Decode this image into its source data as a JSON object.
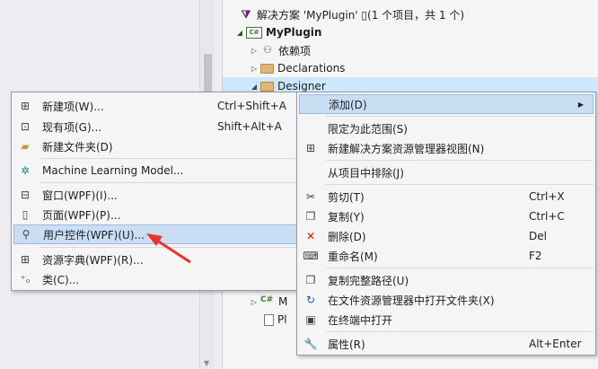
{
  "solution_explorer": {
    "solution_label": "解决方案 'MyPlugin' ▯(1 个项目，共 1 个)",
    "project_label": "MyPlugin",
    "deps_label": "依赖项",
    "declarations_label": "Declarations",
    "designer_label": "Designer",
    "partial_m_label": "M",
    "partial_pl_label": "Pl"
  },
  "left_menu": {
    "items": [
      {
        "icon": "new-item-icon",
        "label": "新建项(W)...",
        "shortcut": "Ctrl+Shift+A"
      },
      {
        "icon": "existing-item-icon",
        "label": "现有项(G)...",
        "shortcut": "Shift+Alt+A"
      },
      {
        "icon": "new-folder-icon",
        "label": "新建文件夹(D)",
        "shortcut": ""
      },
      {
        "icon": "ml-model-icon",
        "label": "Machine Learning Model...",
        "shortcut": ""
      },
      {
        "icon": "window-icon",
        "label": "窗口(WPF)(I)...",
        "shortcut": ""
      },
      {
        "icon": "page-icon",
        "label": "页面(WPF)(P)...",
        "shortcut": ""
      },
      {
        "icon": "user-control-icon",
        "label": "用户控件(WPF)(U)...",
        "shortcut": ""
      },
      {
        "icon": "resource-dictionary-icon",
        "label": "资源字典(WPF)(R)...",
        "shortcut": ""
      },
      {
        "icon": "class-icon",
        "label": "类(C)...",
        "shortcut": ""
      }
    ]
  },
  "right_menu": {
    "items": [
      {
        "icon": "",
        "label": "添加(D)",
        "shortcut": ""
      },
      {
        "icon": "",
        "label": "限定为此范围(S)",
        "shortcut": ""
      },
      {
        "icon": "new-view-icon",
        "label": "新建解决方案资源管理器视图(N)",
        "shortcut": ""
      },
      {
        "icon": "",
        "label": "从项目中排除(J)",
        "shortcut": ""
      },
      {
        "icon": "cut-icon",
        "label": "剪切(T)",
        "shortcut": "Ctrl+X"
      },
      {
        "icon": "copy-icon",
        "label": "复制(Y)",
        "shortcut": "Ctrl+C"
      },
      {
        "icon": "delete-icon",
        "label": "删除(D)",
        "shortcut": "Del"
      },
      {
        "icon": "rename-icon",
        "label": "重命名(M)",
        "shortcut": "F2"
      },
      {
        "icon": "copy-path-icon",
        "label": "复制完整路径(U)",
        "shortcut": ""
      },
      {
        "icon": "open-folder-icon",
        "label": "在文件资源管理器中打开文件夹(X)",
        "shortcut": ""
      },
      {
        "icon": "terminal-icon",
        "label": "在终端中打开",
        "shortcut": ""
      },
      {
        "icon": "properties-icon",
        "label": "属性(R)",
        "shortcut": "Alt+Enter"
      }
    ]
  },
  "colors": {
    "highlight": "#c9def5",
    "annotation_arrow": "#e8332a"
  }
}
